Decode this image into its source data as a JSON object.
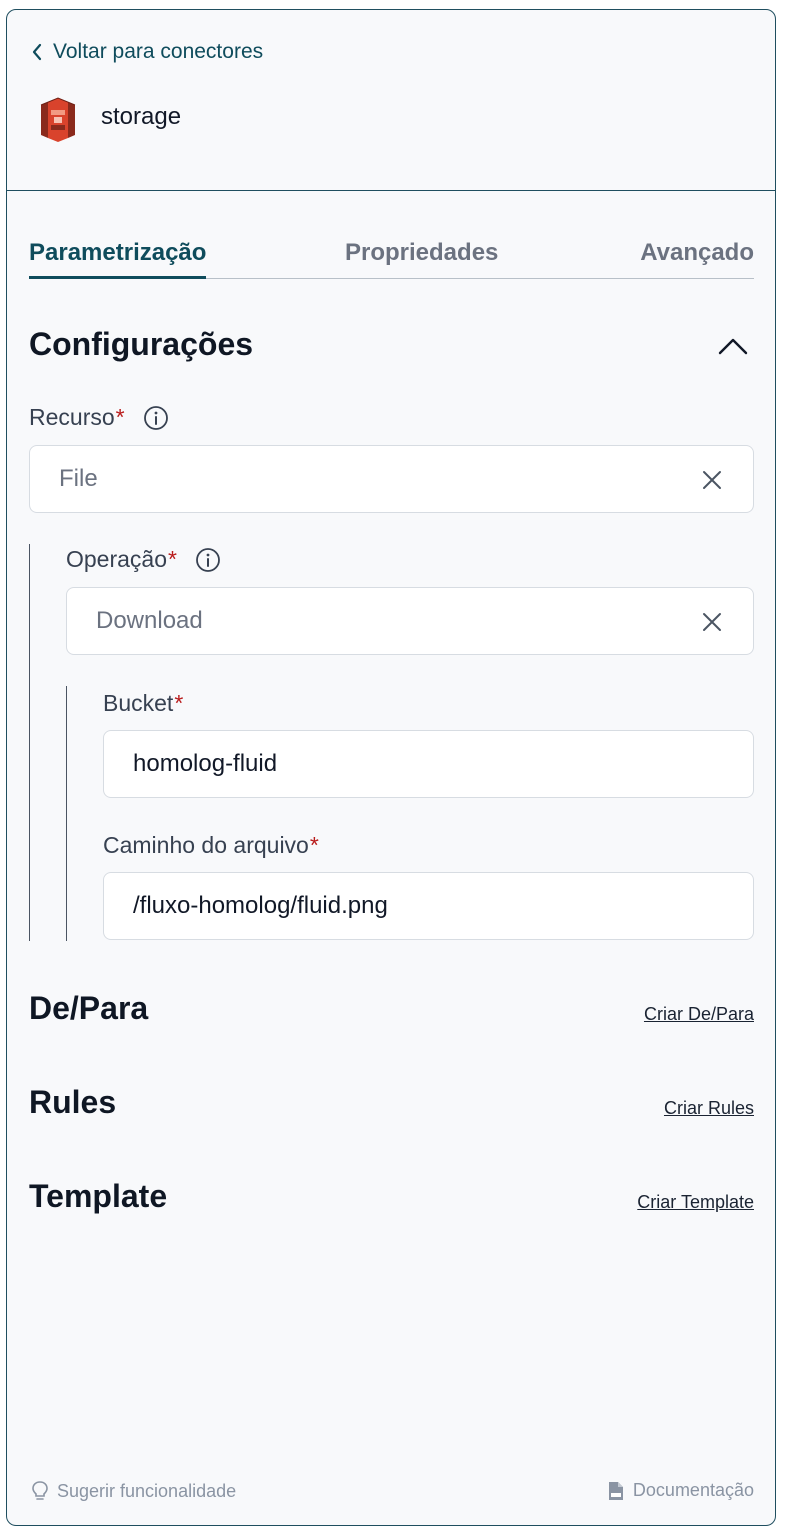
{
  "header": {
    "back_label": "Voltar para conectores",
    "connector_name": "storage"
  },
  "tabs": [
    {
      "label": "Parametrização",
      "active": true
    },
    {
      "label": "Propriedades",
      "active": false
    },
    {
      "label": "Avançado",
      "active": false
    }
  ],
  "config": {
    "title": "Configurações",
    "resource": {
      "label": "Recurso",
      "required_mark": "*",
      "value": "File"
    },
    "operation": {
      "label": "Operação",
      "required_mark": "*",
      "value": "Download"
    },
    "bucket": {
      "label": "Bucket",
      "required_mark": "*",
      "value": "homolog-fluid"
    },
    "file_path": {
      "label": "Caminho do arquivo",
      "required_mark": "*",
      "value": "/fluxo-homolog/fluid.png"
    }
  },
  "sections": {
    "depara": {
      "title": "De/Para",
      "link": "Criar De/Para"
    },
    "rules": {
      "title": "Rules",
      "link": "Criar Rules"
    },
    "template": {
      "title": "Template",
      "link": "Criar Template"
    }
  },
  "footer": {
    "suggest": "Sugerir funcionalidade",
    "docs": "Documentação"
  },
  "colors": {
    "accent": "#0f4c5c",
    "required": "#b91c1c",
    "logo": "#d9432c"
  },
  "icons": [
    "chevron-left-icon",
    "s3-bucket-logo",
    "chevron-up-icon",
    "info-icon",
    "close-icon",
    "lightbulb-icon",
    "document-icon"
  ]
}
